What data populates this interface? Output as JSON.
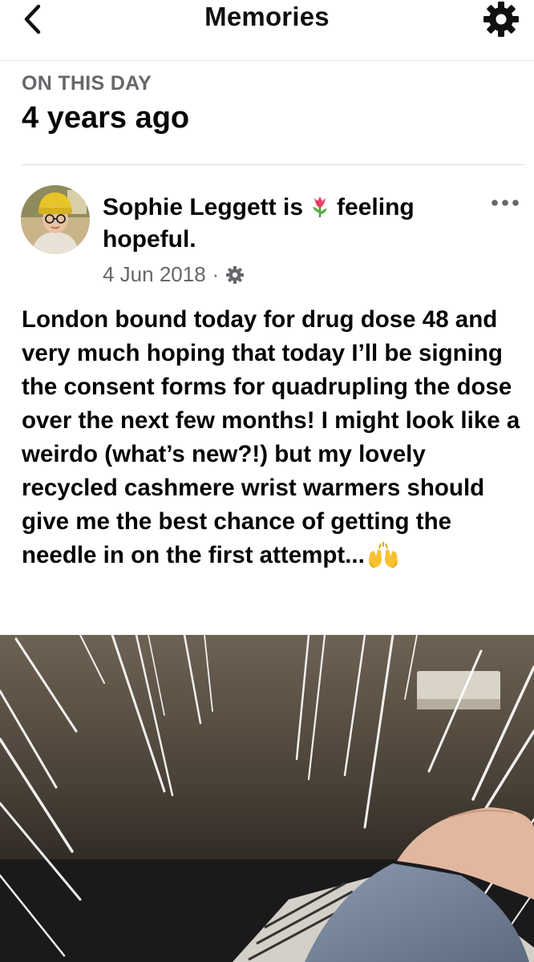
{
  "header": {
    "title": "Memories",
    "back_icon": "chevron-left-icon",
    "settings_icon": "gear-icon"
  },
  "memory": {
    "label": "ON THIS DAY",
    "title": "4 years ago"
  },
  "post": {
    "author": "Sophie Leggett",
    "verb": "is",
    "feeling_emoji": "tulip-icon",
    "feeling_text": "feeling hopeful.",
    "date": "4 Jun 2018",
    "separator": "·",
    "audience_icon": "gear-icon",
    "more_icon": "more-horizontal-icon",
    "body": "London bound today for drug dose 48 and very much hoping that today I’ll be signing the consent forms for quadrupling the dose over the next few months! I might look like a weirdo (what’s new?!) but my lovely recycled cashmere wrist warmers should give me the best chance of getting the needle in on the first attempt...",
    "body_emoji": "raising-hands-icon",
    "photo_subject": "photo"
  },
  "colors": {
    "text_primary": "#050505",
    "text_secondary": "#65676b",
    "divider": "#dadde1"
  }
}
